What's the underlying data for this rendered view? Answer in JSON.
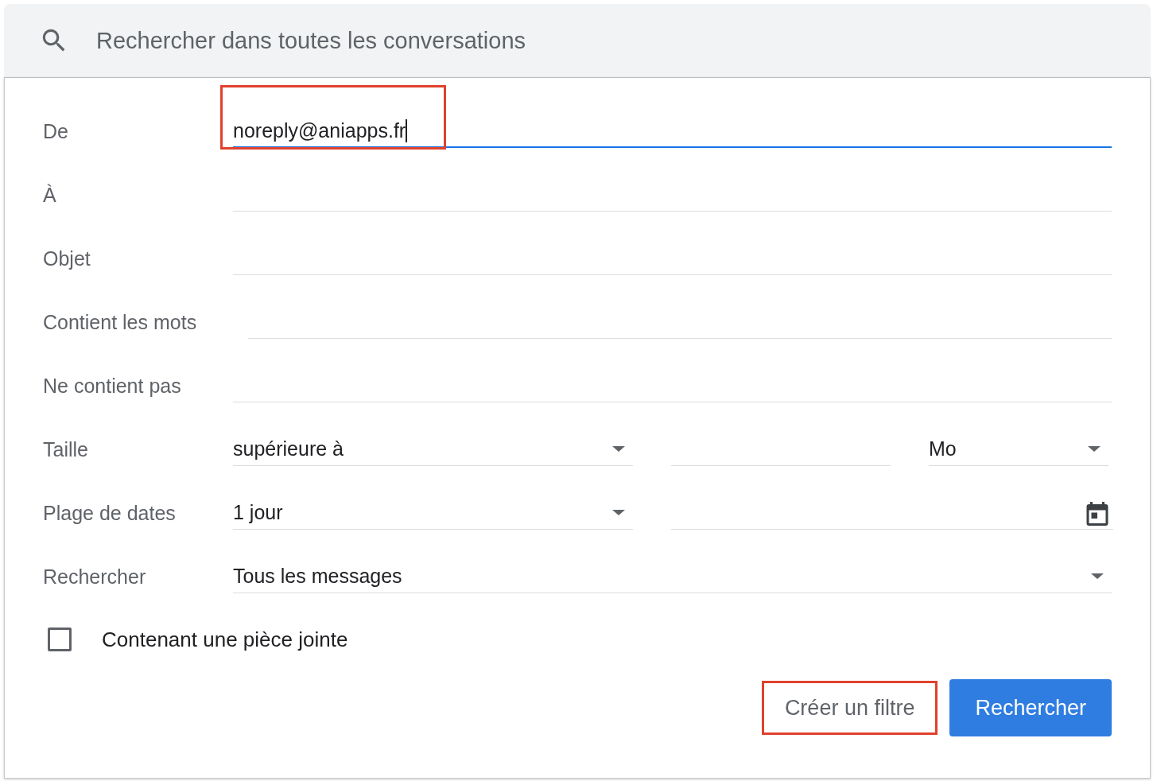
{
  "search": {
    "placeholder": "Rechercher dans toutes les conversations"
  },
  "rows": [
    {
      "kind": "text",
      "label": "De",
      "value": "noreply@aniapps.fr",
      "focused": true,
      "highlighted": true
    },
    {
      "kind": "text",
      "label": "À",
      "value": "",
      "focused": false,
      "highlighted": false
    },
    {
      "kind": "text",
      "label": "Objet",
      "value": "",
      "focused": false,
      "highlighted": false
    },
    {
      "kind": "text",
      "label": "Contient les mots",
      "value": "",
      "focused": false,
      "highlighted": false
    },
    {
      "kind": "text",
      "label": "Ne contient pas",
      "value": "",
      "focused": false,
      "highlighted": false
    },
    {
      "kind": "size",
      "label": "Taille",
      "select": "supérieure à",
      "unit": "Mo"
    },
    {
      "kind": "daterange",
      "label": "Plage de dates",
      "select": "1 jour"
    },
    {
      "kind": "select",
      "label": "Rechercher",
      "select": "Tous les messages"
    }
  ],
  "attachment": {
    "label": "Contenant une pièce jointe",
    "checked": false
  },
  "buttons": [
    {
      "kind": "text",
      "label": "Créer un filtre",
      "highlighted": true
    },
    {
      "kind": "primary",
      "label": "Rechercher",
      "highlighted": false
    }
  ]
}
